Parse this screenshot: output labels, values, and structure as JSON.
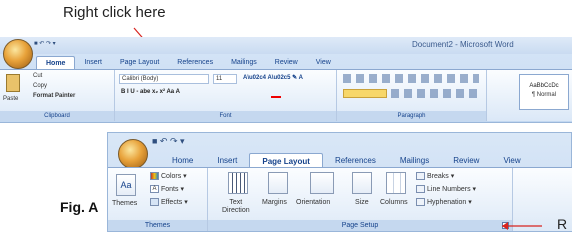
{
  "instruction_top": "Right click here",
  "figure_label": "Fig. A",
  "instruction_right": "R",
  "top_ribbon": {
    "qat": "■ ↶ ↷ ▾",
    "title": "Document2 - Microsoft Word",
    "tabs": [
      "Home",
      "Insert",
      "Page Layout",
      "References",
      "Mailings",
      "Review",
      "View"
    ],
    "clipboard": {
      "paste": "Paste",
      "cut": "Cut",
      "copy": "Copy",
      "format_painter": "Format Painter",
      "label": "Clipboard"
    },
    "font": {
      "name": "Calibri (Body)",
      "size": "11",
      "label": "Font",
      "row2": "B  I  U  - abe  x₂  x²  Aa  A"
    },
    "paragraph": {
      "label": "Paragraph"
    },
    "styles": {
      "preview": "AaBbCcDc",
      "name": "¶ Normal"
    }
  },
  "bottom_ribbon": {
    "qat": "■ ↶ ↷ ▾",
    "tabs": [
      "Home",
      "Insert",
      "Page Layout",
      "References",
      "Mailings",
      "Review",
      "View"
    ],
    "themes": {
      "btn": "Themes",
      "colors": "Colors",
      "fonts": "Fonts",
      "effects": "Effects",
      "label": "Themes"
    },
    "page_setup": {
      "text_direction": [
        "Text",
        "Direction"
      ],
      "margins": "Margins",
      "orientation": "Orientation",
      "size": "Size",
      "columns": "Columns",
      "breaks": "Breaks",
      "line_numbers": "Line Numbers",
      "hyphenation": "Hyphenation",
      "label": "Page Setup"
    }
  },
  "colors": {
    "arrow": "#d8241f",
    "tab_text": "#15428b"
  }
}
